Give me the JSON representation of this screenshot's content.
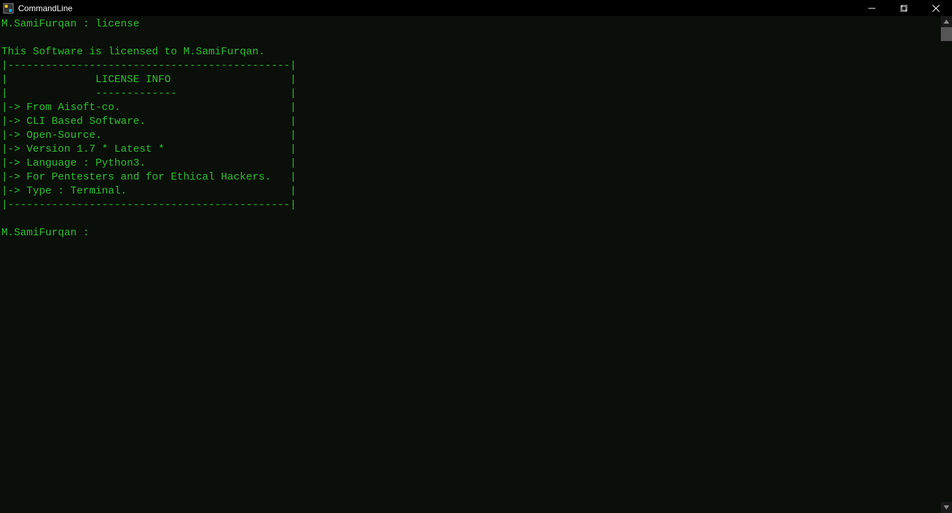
{
  "window": {
    "title": "CommandLine"
  },
  "terminal": {
    "prompt_user": "M.SamiFurqan",
    "prompt_separator": " : ",
    "command": "license",
    "blank1": "",
    "licensed_to": "This Software is licensed to M.SamiFurqan.",
    "box_top": "|---------------------------------------------|",
    "box_title": "|              LICENSE INFO                   |",
    "box_rule": "|              -------------                  |",
    "box_l1": "|-> From Aisoft-co.                           |",
    "box_l2": "|-> CLI Based Software.                       |",
    "box_l3": "|-> Open-Source.                              |",
    "box_l4": "|-> Version 1.7 * Latest *                    |",
    "box_l5": "|-> Language : Python3.                       |",
    "box_l6": "|-> For Pentesters and for Ethical Hackers.   |",
    "box_l7": "|-> Type : Terminal.                          |",
    "box_bottom": "|---------------------------------------------|",
    "blank2": "",
    "prompt2": "M.SamiFurqan : "
  }
}
